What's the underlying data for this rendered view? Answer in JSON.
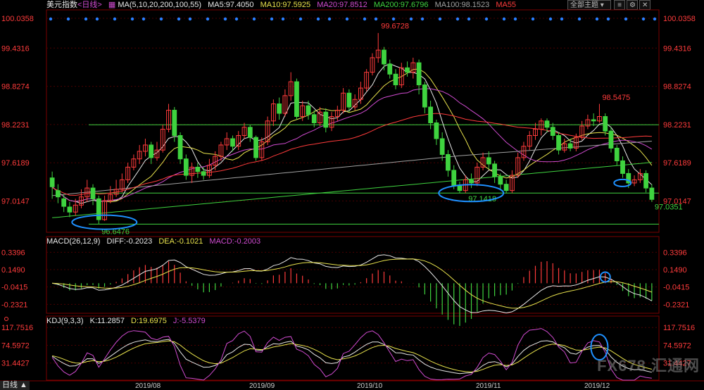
{
  "header": {
    "symbol": "美元指数",
    "period": "<日线>",
    "ma_params": "MA(5,10,20,200,100,55)",
    "ma5": "MA5:97.4050",
    "ma10": "MA10:97.5925",
    "ma20": "MA20:97.8512",
    "ma200": "MA200:97.6796",
    "ma100": "MA100:98.1523",
    "ma55": "MA55",
    "theme_button": "全部主题",
    "colors": {
      "ma5": "#e8e8e8",
      "ma10": "#e8e24c",
      "ma20": "#d04bd0",
      "ma200": "#3fd33f",
      "ma100": "#a0a0a0",
      "ma55": "#ff3b3b"
    }
  },
  "macd_header": {
    "params": "MACD(26,12,9)",
    "diff": "DIFF:-0.2023",
    "dea": "DEA:-0.1021",
    "macd": "MACD:-0.2003"
  },
  "kdj_header": {
    "params": "KDJ(9,3,3)",
    "k": "K:11.2857",
    "d": "D:19.6975",
    "j": "J:-5.5379"
  },
  "footer": {
    "period_tab": "日线 ▲",
    "watermark": "FX678 汇通网"
  },
  "chart_data": [
    {
      "type": "candlestick",
      "name": "price",
      "y_ticks": [
        "100.0358",
        "99.4316",
        "98.8274",
        "98.2231",
        "97.6189",
        "97.0147"
      ],
      "ylim": [
        96.52,
        100.0358
      ],
      "x_ticks": [
        "2019/08",
        "2019/09",
        "2019/10",
        "2019/11",
        "2019/12"
      ],
      "annotations": [
        {
          "label": "99.6728",
          "value": 99.6728
        },
        {
          "label": "98.5475",
          "value": 98.5475
        },
        {
          "label": "97.1418",
          "value": 97.1418
        },
        {
          "label": "97.0351",
          "value": 97.0351
        },
        {
          "label": "96.6476",
          "value": 96.6476
        }
      ],
      "horizontal_lines": [
        98.22,
        97.14,
        96.65
      ],
      "candles": [
        [
          97.38,
          97.24,
          97.48,
          97.05
        ],
        [
          97.18,
          97.08,
          97.28,
          96.98
        ],
        [
          97.05,
          96.93,
          97.12,
          96.84
        ],
        [
          96.92,
          96.84,
          97.0,
          96.76
        ],
        [
          96.84,
          96.95,
          97.05,
          96.78
        ],
        [
          96.95,
          97.08,
          97.2,
          96.9
        ],
        [
          97.08,
          97.22,
          97.35,
          97.0
        ],
        [
          97.22,
          97.05,
          97.28,
          96.95
        ],
        [
          97.05,
          96.72,
          97.1,
          96.65
        ],
        [
          96.72,
          97.02,
          97.1,
          96.7
        ],
        [
          97.02,
          97.12,
          97.25,
          96.98
        ],
        [
          97.12,
          97.2,
          97.35,
          97.08
        ],
        [
          97.2,
          97.35,
          97.45,
          97.15
        ],
        [
          97.35,
          97.55,
          97.62,
          97.3
        ],
        [
          97.55,
          97.68,
          97.75,
          97.5
        ],
        [
          97.68,
          97.8,
          97.9,
          97.6
        ],
        [
          97.8,
          97.9,
          98.0,
          97.72
        ],
        [
          97.9,
          97.7,
          97.95,
          97.6
        ],
        [
          97.7,
          97.82,
          97.95,
          97.65
        ],
        [
          97.82,
          98.15,
          98.22,
          97.78
        ],
        [
          98.15,
          98.45,
          98.55,
          98.1
        ],
        [
          98.45,
          98.05,
          98.5,
          97.95
        ],
        [
          98.05,
          97.68,
          98.1,
          97.6
        ],
        [
          97.68,
          97.42,
          97.75,
          97.35
        ],
        [
          97.42,
          97.55,
          97.62,
          97.3
        ],
        [
          97.55,
          97.48,
          97.62,
          97.38
        ],
        [
          97.48,
          97.42,
          97.55,
          97.35
        ],
        [
          97.42,
          97.58,
          97.68,
          97.38
        ],
        [
          97.58,
          97.72,
          97.8,
          97.5
        ],
        [
          97.72,
          97.9,
          97.95,
          97.65
        ],
        [
          97.9,
          98.0,
          98.1,
          97.82
        ],
        [
          98.0,
          97.88,
          98.05,
          97.8
        ],
        [
          97.88,
          98.05,
          98.12,
          97.82
        ],
        [
          98.05,
          98.18,
          98.25,
          98.0
        ],
        [
          98.18,
          98.02,
          98.22,
          97.95
        ],
        [
          98.02,
          97.7,
          98.05,
          97.65
        ],
        [
          97.7,
          97.95,
          98.02,
          97.65
        ],
        [
          97.95,
          98.28,
          98.35,
          97.9
        ],
        [
          98.28,
          98.55,
          98.62,
          98.2
        ],
        [
          98.55,
          98.4,
          98.65,
          98.3
        ],
        [
          98.4,
          98.68,
          98.78,
          98.35
        ],
        [
          98.68,
          98.9,
          99.05,
          98.6
        ],
        [
          98.9,
          98.35,
          98.95,
          98.3
        ],
        [
          98.35,
          98.52,
          98.6,
          98.28
        ],
        [
          98.52,
          98.38,
          98.6,
          98.3
        ],
        [
          98.38,
          98.25,
          98.45,
          98.18
        ],
        [
          98.25,
          98.42,
          98.5,
          98.2
        ],
        [
          98.42,
          98.18,
          98.48,
          98.1
        ],
        [
          98.18,
          98.35,
          98.42,
          98.12
        ],
        [
          98.35,
          98.45,
          98.52,
          98.28
        ],
        [
          98.45,
          98.72,
          98.8,
          98.4
        ],
        [
          98.72,
          98.5,
          98.78,
          98.42
        ],
        [
          98.5,
          98.62,
          98.7,
          98.45
        ],
        [
          98.62,
          98.8,
          98.9,
          98.55
        ],
        [
          98.8,
          99.05,
          99.1,
          98.75
        ],
        [
          99.05,
          99.28,
          99.35,
          99.0
        ],
        [
          99.28,
          99.4,
          99.67,
          99.2
        ],
        [
          99.4,
          99.18,
          99.45,
          99.08
        ],
        [
          99.18,
          99.02,
          99.25,
          98.95
        ],
        [
          99.02,
          98.85,
          99.1,
          98.78
        ],
        [
          98.85,
          99.12,
          99.2,
          98.8
        ],
        [
          99.12,
          99.05,
          99.22,
          98.98
        ],
        [
          99.05,
          99.2,
          99.28,
          98.95
        ],
        [
          99.2,
          98.85,
          99.25,
          98.7
        ],
        [
          98.85,
          98.5,
          98.9,
          98.4
        ],
        [
          98.5,
          98.25,
          98.6,
          98.15
        ],
        [
          98.25,
          98.0,
          98.3,
          97.9
        ],
        [
          98.0,
          97.75,
          98.1,
          97.65
        ],
        [
          97.75,
          97.5,
          97.82,
          97.4
        ],
        [
          97.5,
          97.25,
          97.58,
          97.2
        ],
        [
          97.25,
          97.18,
          97.32,
          97.14
        ],
        [
          97.18,
          97.35,
          97.42,
          97.14
        ],
        [
          97.35,
          97.3,
          97.45,
          97.22
        ],
        [
          97.3,
          97.55,
          97.62,
          97.25
        ],
        [
          97.55,
          97.7,
          97.78,
          97.5
        ],
        [
          97.7,
          97.6,
          97.8,
          97.52
        ],
        [
          97.6,
          97.4,
          97.65,
          97.3
        ],
        [
          97.4,
          97.28,
          97.45,
          97.2
        ],
        [
          97.28,
          97.18,
          97.35,
          97.14
        ],
        [
          97.18,
          97.42,
          97.5,
          97.14
        ],
        [
          97.42,
          97.7,
          97.78,
          97.38
        ],
        [
          97.7,
          97.88,
          97.95,
          97.65
        ],
        [
          97.88,
          98.05,
          98.12,
          97.82
        ],
        [
          98.05,
          98.15,
          98.25,
          97.98
        ],
        [
          98.15,
          98.28,
          98.32,
          98.05
        ],
        [
          98.28,
          98.18,
          98.32,
          98.1
        ],
        [
          98.18,
          98.05,
          98.25,
          97.98
        ],
        [
          98.05,
          97.82,
          98.1,
          97.75
        ],
        [
          97.82,
          97.92,
          98.0,
          97.78
        ],
        [
          97.92,
          97.85,
          98.0,
          97.8
        ],
        [
          97.85,
          98.02,
          98.08,
          97.8
        ],
        [
          98.02,
          98.2,
          98.28,
          97.98
        ],
        [
          98.2,
          98.3,
          98.38,
          98.15
        ],
        [
          98.3,
          98.28,
          98.4,
          98.2
        ],
        [
          98.28,
          98.35,
          98.55,
          98.25
        ],
        [
          98.35,
          98.12,
          98.4,
          98.05
        ],
        [
          98.12,
          97.85,
          98.18,
          97.78
        ],
        [
          97.85,
          97.65,
          97.9,
          97.58
        ],
        [
          97.65,
          97.45,
          97.72,
          97.38
        ],
        [
          97.45,
          97.3,
          97.52,
          97.22
        ],
        [
          97.3,
          97.35,
          97.42,
          97.25
        ],
        [
          97.35,
          97.45,
          97.52,
          97.3
        ],
        [
          97.45,
          97.22,
          97.5,
          97.15
        ],
        [
          97.22,
          97.04,
          97.28,
          97.0
        ]
      ],
      "series": [
        {
          "name": "MA5",
          "color": "#e8e8e8"
        },
        {
          "name": "MA10",
          "color": "#e8e24c"
        },
        {
          "name": "MA20",
          "color": "#d04bd0"
        },
        {
          "name": "MA200",
          "color": "#3fd33f"
        },
        {
          "name": "MA100",
          "color": "#a0a0a0"
        },
        {
          "name": "MA55",
          "color": "#ff3b3b"
        }
      ]
    },
    {
      "type": "macd",
      "name": "macd",
      "y_ticks": [
        "0.3396",
        "0.1490",
        "-0.0415",
        "-0.2321"
      ],
      "ylim": [
        -0.33,
        0.42
      ],
      "diff_color": "#e8e8e8",
      "dea_color": "#e8e24c"
    },
    {
      "type": "kdj",
      "name": "kdj",
      "y_ticks": [
        "117.7516",
        "74.5972",
        "31.4427"
      ],
      "ylim": [
        -10,
        125
      ],
      "k_color": "#e8e8e8",
      "d_color": "#e8e24c",
      "j_color": "#d04bd0"
    }
  ]
}
